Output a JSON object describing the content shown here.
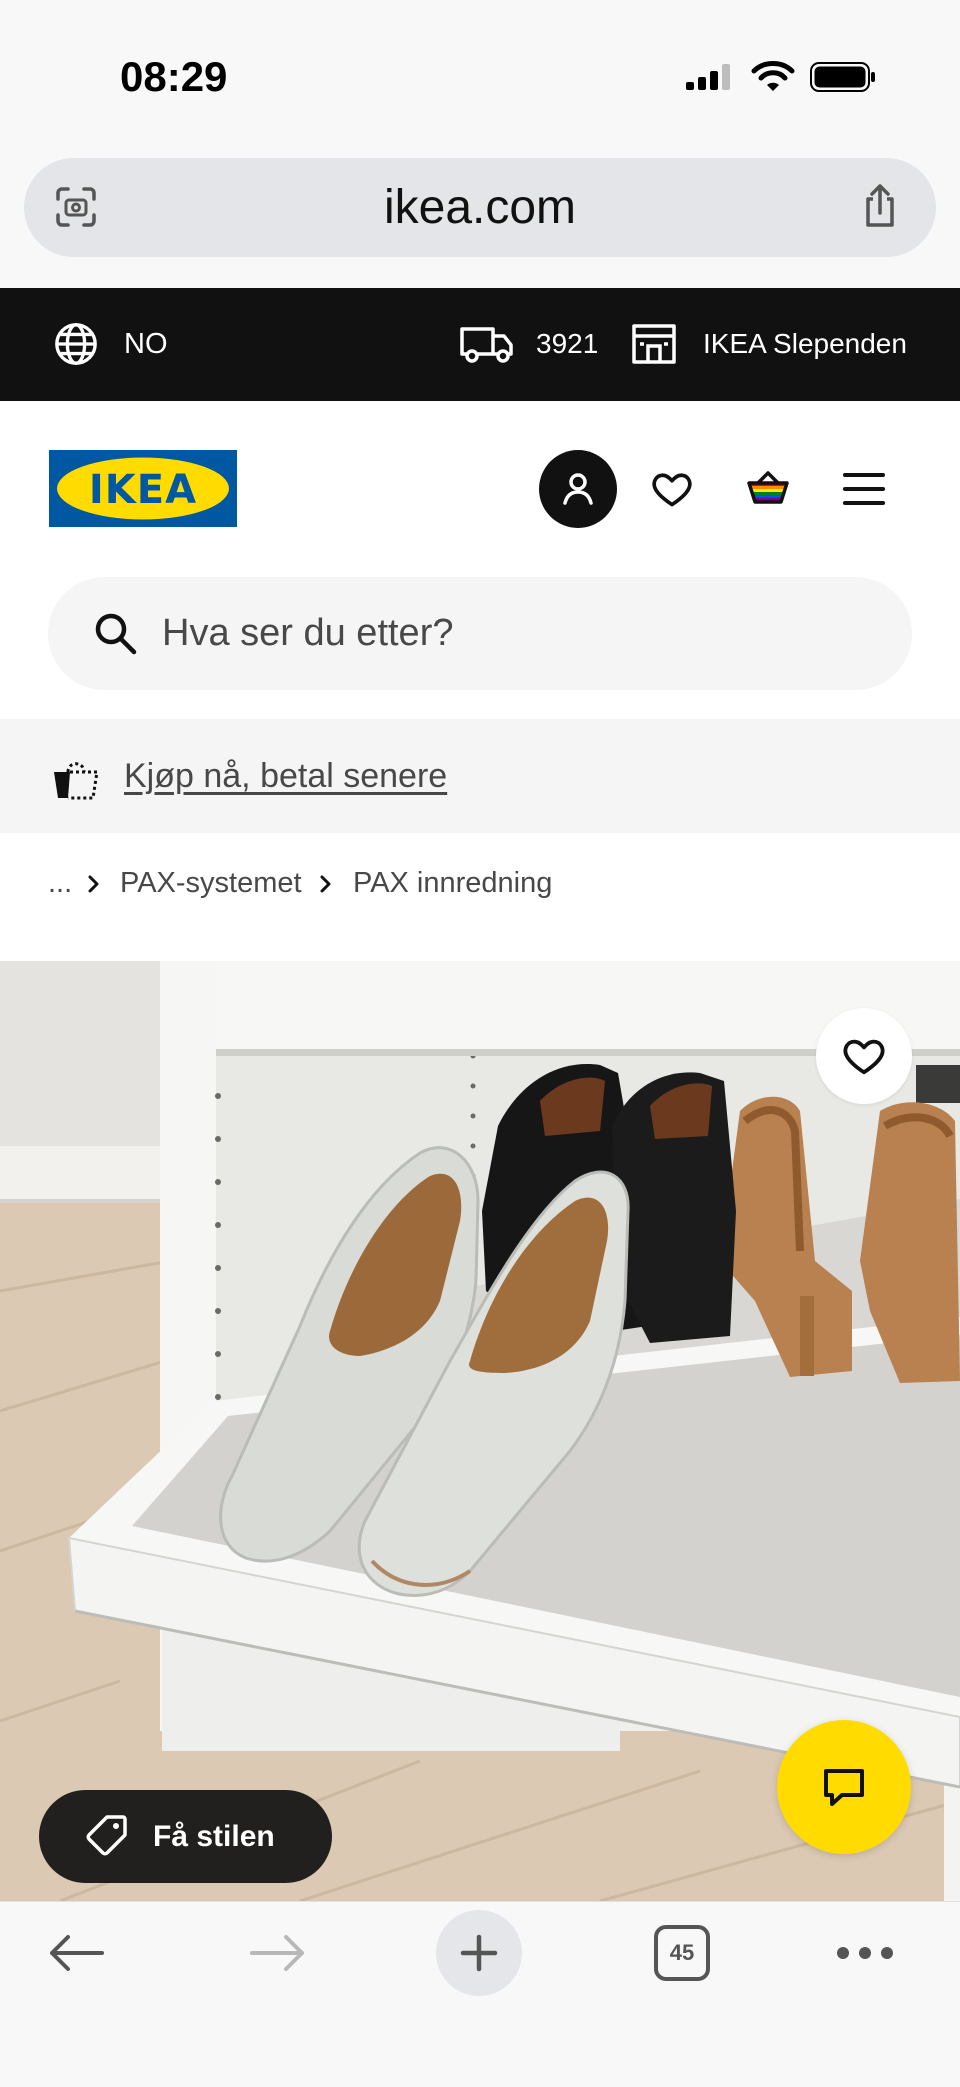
{
  "status_bar": {
    "time": "08:29"
  },
  "browser": {
    "url": "ikea.com",
    "tab_count": "45"
  },
  "top_bar": {
    "country": "NO",
    "delivery_postcode": "3921",
    "store_name": "IKEA Slependen"
  },
  "header": {
    "logo_text": "IKEA"
  },
  "search": {
    "placeholder": "Hva ser du etter?"
  },
  "promo_banner": {
    "link_text": "Kjøp nå, betal senere"
  },
  "breadcrumb": {
    "items": [
      "...",
      "PAX-systemet",
      "PAX innredning"
    ]
  },
  "product_gallery": {
    "get_the_look_label": "Få stilen"
  },
  "icons": {
    "signal": "cellular-signal-icon",
    "wifi": "wifi-icon",
    "battery": "battery-icon",
    "camera_search": "camera-search-icon",
    "share": "share-icon",
    "globe": "globe-icon",
    "truck": "delivery-truck-icon",
    "store": "store-icon",
    "profile": "profile-icon",
    "wishlist": "heart-icon",
    "basket": "shopping-basket-icon",
    "menu": "hamburger-menu-icon",
    "search": "search-icon",
    "pay_later": "pay-later-bag-icon",
    "breadcrumb_separator": "chevron-right-icon",
    "tag": "tag-icon",
    "chat": "chat-icon",
    "back": "arrow-left-icon",
    "forward": "arrow-right-icon",
    "new_tab": "plus-icon",
    "tabs": "tabs-icon",
    "more": "more-dots-icon"
  },
  "colors": {
    "brand_blue": "#0058a3",
    "brand_yellow": "#ffdb00",
    "top_bar_bg": "#111111",
    "search_bg": "#f5f5f5",
    "chat_button": "#ffdb00",
    "text_secondary": "#484848"
  }
}
